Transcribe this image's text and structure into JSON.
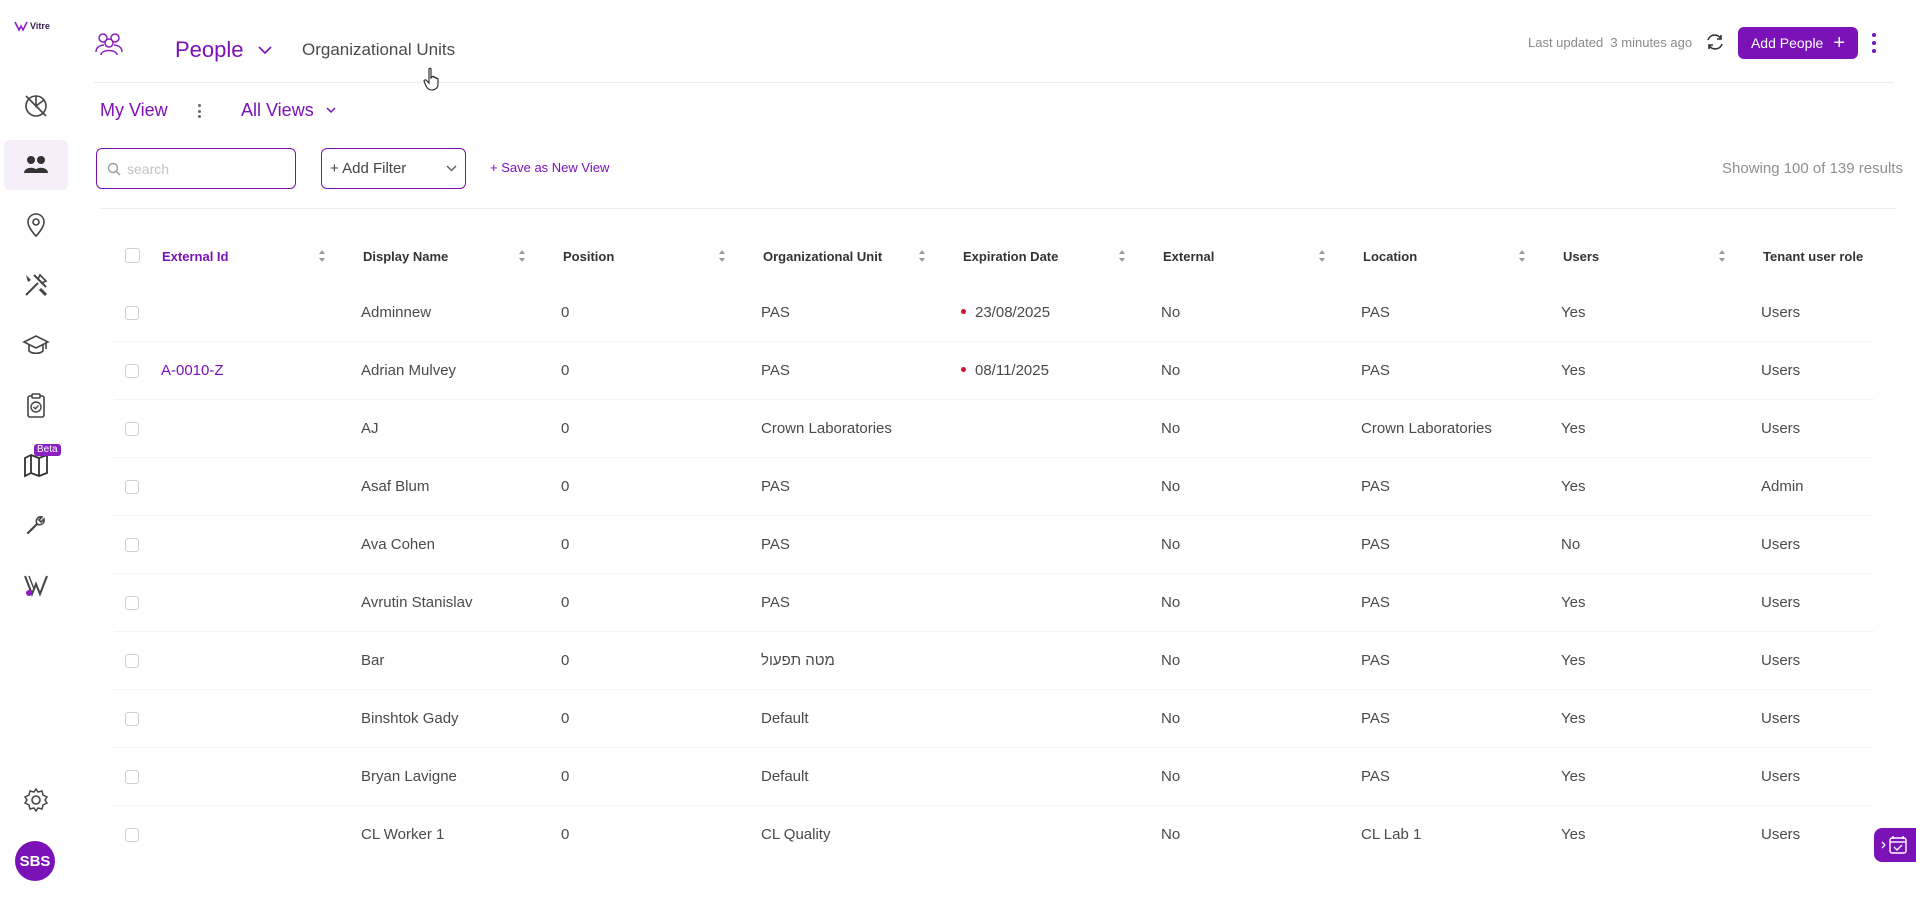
{
  "app": {
    "logo_text": "Vitre"
  },
  "colors": {
    "accent": "#7b12b8",
    "expiry_dot": "#d0142c"
  },
  "sidebar": {
    "items": [
      {
        "icon": "dashboard-icon"
      },
      {
        "icon": "people-icon",
        "active": true
      },
      {
        "icon": "location-pin-icon"
      },
      {
        "icon": "tools-icon"
      },
      {
        "icon": "graduation-cap-icon"
      },
      {
        "icon": "clipboard-check-icon"
      },
      {
        "icon": "map-icon",
        "badge": "Beta"
      },
      {
        "icon": "wrench-icon"
      },
      {
        "icon": "vitre-v-icon"
      }
    ],
    "settings_icon": "gear-icon",
    "avatar_initials": "SBS"
  },
  "header": {
    "tabs": {
      "people": "People",
      "org_units": "Organizational Units"
    },
    "last_updated_label": "Last updated",
    "last_updated_value": "3 minutes ago",
    "add_people_label": "Add People"
  },
  "views": {
    "my_view": "My View",
    "all_views": "All Views"
  },
  "toolbar": {
    "search_placeholder": "search",
    "add_filter_label": "+ Add Filter",
    "save_view_label": "+ Save as New View",
    "showing_text": "Showing 100 of 139 results"
  },
  "table": {
    "columns": [
      "External Id",
      "Display Name",
      "Position",
      "Organizational Unit",
      "Expiration Date",
      "External",
      "Location",
      "Users",
      "Tenant user role"
    ],
    "rows": [
      {
        "external_id": "",
        "display_name": "Adminnew",
        "position": "0",
        "org_unit": "PAS",
        "expiration": "23/08/2025",
        "external": "No",
        "location": "PAS",
        "users": "Yes",
        "role": "Users"
      },
      {
        "external_id": "A-0010-Z",
        "display_name": "Adrian Mulvey",
        "position": "0",
        "org_unit": "PAS",
        "expiration": "08/11/2025",
        "external": "No",
        "location": "PAS",
        "users": "Yes",
        "role": "Users"
      },
      {
        "external_id": "",
        "display_name": "AJ",
        "position": "0",
        "org_unit": "Crown Laboratories",
        "expiration": "",
        "external": "No",
        "location": "Crown Laboratories",
        "users": "Yes",
        "role": "Users"
      },
      {
        "external_id": "",
        "display_name": "Asaf Blum",
        "position": "0",
        "org_unit": "PAS",
        "expiration": "",
        "external": "No",
        "location": "PAS",
        "users": "Yes",
        "role": "Admin"
      },
      {
        "external_id": "",
        "display_name": "Ava Cohen",
        "position": "0",
        "org_unit": "PAS",
        "expiration": "",
        "external": "No",
        "location": "PAS",
        "users": "No",
        "role": "Users"
      },
      {
        "external_id": "",
        "display_name": "Avrutin Stanislav",
        "position": "0",
        "org_unit": "PAS",
        "expiration": "",
        "external": "No",
        "location": "PAS",
        "users": "Yes",
        "role": "Users"
      },
      {
        "external_id": "",
        "display_name": "Bar",
        "position": "0",
        "org_unit": "מטה תפעול",
        "expiration": "",
        "external": "No",
        "location": "PAS",
        "users": "Yes",
        "role": "Users"
      },
      {
        "external_id": "",
        "display_name": "Binshtok Gady",
        "position": "0",
        "org_unit": "Default",
        "expiration": "",
        "external": "No",
        "location": "PAS",
        "users": "Yes",
        "role": "Users"
      },
      {
        "external_id": "",
        "display_name": "Bryan Lavigne",
        "position": "0",
        "org_unit": "Default",
        "expiration": "",
        "external": "No",
        "location": "PAS",
        "users": "Yes",
        "role": "Users"
      },
      {
        "external_id": "",
        "display_name": "CL Worker 1",
        "position": "0",
        "org_unit": "CL Quality",
        "expiration": "",
        "external": "No",
        "location": "CL Lab 1",
        "users": "Yes",
        "role": "Users"
      }
    ]
  }
}
